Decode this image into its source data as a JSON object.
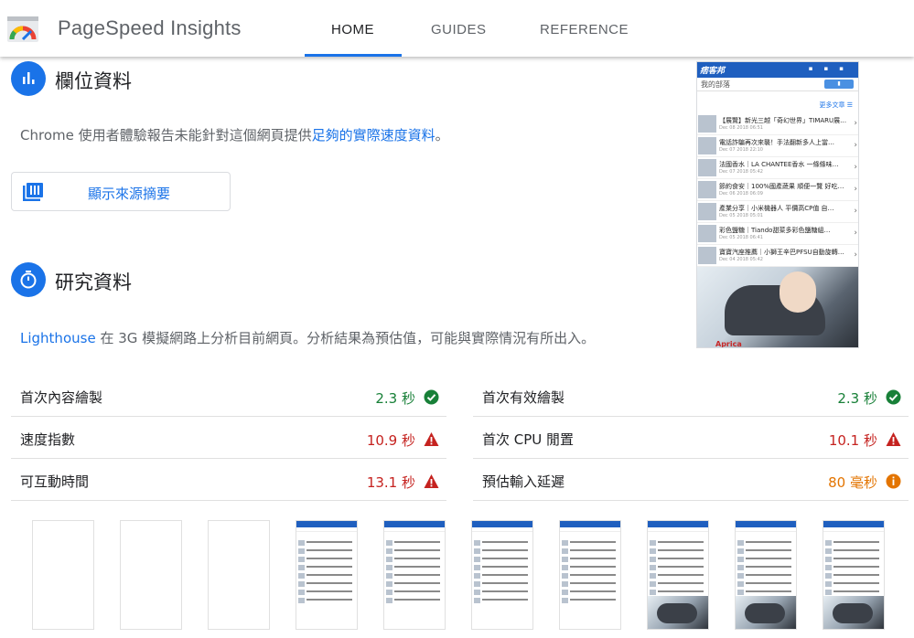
{
  "header": {
    "title": "PageSpeed Insights",
    "tabs": [
      {
        "label": "HOME"
      },
      {
        "label": "GUIDES"
      },
      {
        "label": "REFERENCE"
      }
    ]
  },
  "field_data": {
    "title": "欄位資料",
    "description_prefix": "Chrome 使用者體驗報告未能針對這個網頁提供",
    "description_link": "足夠的實際速度資料",
    "description_suffix": "。",
    "show_source_button": "顯示來源摘要"
  },
  "lab_data": {
    "title": "研究資料",
    "description_link": "Lighthouse",
    "description_rest": " 在 3G 模擬網路上分析目前網頁。分析結果為預估值，可能與實際情況有所出入。",
    "metrics": [
      {
        "label": "首次內容繪製",
        "value": "2.3 秒",
        "status": "pass",
        "icon": "check-circle-icon"
      },
      {
        "label": "首次有效繪製",
        "value": "2.3 秒",
        "status": "pass",
        "icon": "check-circle-icon"
      },
      {
        "label": "速度指數",
        "value": "10.9 秒",
        "status": "fail",
        "icon": "warning-triangle-icon"
      },
      {
        "label": "首次 CPU 閒置",
        "value": "10.1 秒",
        "status": "fail",
        "icon": "warning-triangle-icon"
      },
      {
        "label": "可互動時間",
        "value": "13.1 秒",
        "status": "fail",
        "icon": "warning-triangle-icon"
      },
      {
        "label": "預估輸入延遲",
        "value": "80 毫秒",
        "status": "average",
        "icon": "info-circle-icon"
      }
    ]
  },
  "screenshot": {
    "brand": "痞客邦",
    "back_label": "我的部落",
    "more_label": "更多文章 ☰",
    "articles": [
      {
        "title": "【展覽】新光三越「奇幻世界」TIMARU展…",
        "date": "Dec 08 2018 06:51"
      },
      {
        "title": "電話詐騙再次來襲！手法翻新多人上當…",
        "date": "Dec 07 2018 22:10"
      },
      {
        "title": "法國香水｜LA CHANTEE香水 一條條味…",
        "date": "Dec 07 2018 05:42"
      },
      {
        "title": "節約食安｜100%國產蔬果 順便一覽 好吃…",
        "date": "Dec 06 2018 06:09"
      },
      {
        "title": "產業分享｜小米機器人 平價高CP值 自…",
        "date": "Dec 05 2018 05:01"
      },
      {
        "title": "彩色鹽糖｜Tiando甜菜多彩色鹽糖組…",
        "date": "Dec 05 2018 06:41"
      },
      {
        "title": "寶寶汽座推薦｜小獅王辛巴PFSU自動旋轉…",
        "date": "Dec 04 2018 05:42"
      }
    ],
    "ad_text": "Aprica"
  },
  "colors": {
    "accent": "#1a73e8",
    "pass": "#188038",
    "fail": "#c5221f",
    "average": "#e37400"
  }
}
